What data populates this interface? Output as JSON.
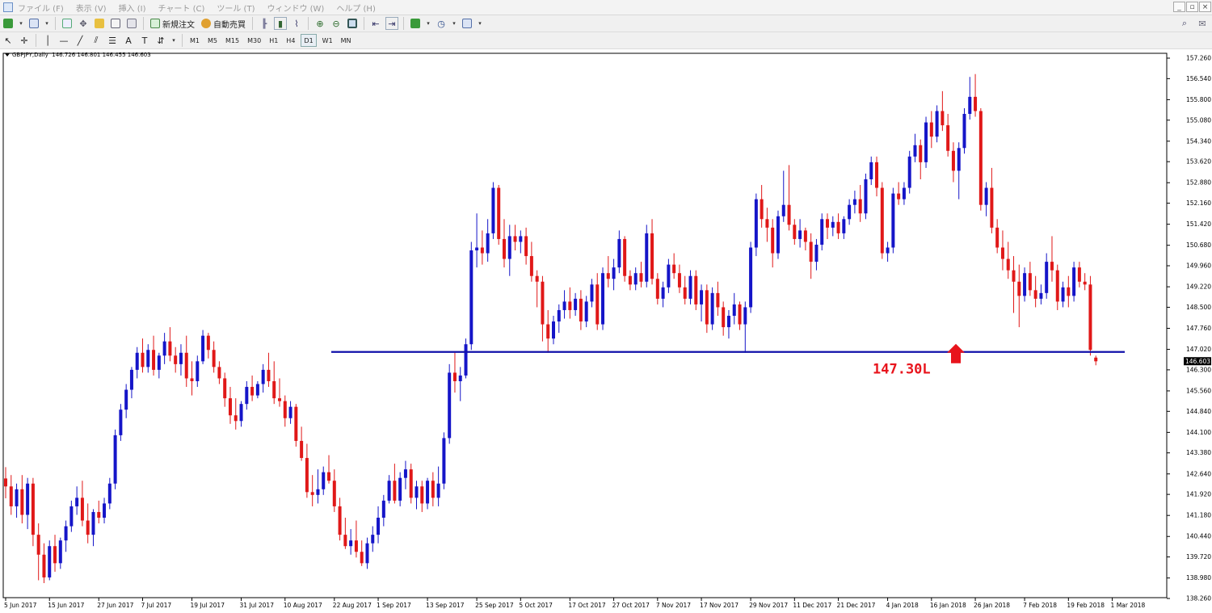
{
  "menu": {
    "items": [
      "ファイル (F)",
      "表示 (V)",
      "挿入 (I)",
      "チャート (C)",
      "ツール (T)",
      "ウィンドウ (W)",
      "ヘルプ (H)"
    ]
  },
  "toolbar": {
    "new_order_label": "新規注文",
    "auto_trading_label": "自動売買",
    "timeframes": [
      "M1",
      "M5",
      "M15",
      "M30",
      "H1",
      "H4",
      "D1",
      "W1",
      "MN"
    ],
    "active_timeframe": "D1"
  },
  "chart_title": {
    "symbol": "GBPJPY,Daily",
    "ohlc": "146.726 146.801 146.455 146.603"
  },
  "annotation": {
    "label": "147.30L",
    "color": "#e8141c"
  },
  "colors": {
    "bull": "#1515c8",
    "bear": "#e01818",
    "support_line": "#1111aa",
    "price_tag_bg": "#000000"
  },
  "chart_data": {
    "type": "candlestick",
    "symbol": "GBPJPY",
    "timeframe": "Daily",
    "y_axis": {
      "min": 138.26,
      "max": 157.26,
      "ticks": [
        157.26,
        156.54,
        155.8,
        155.08,
        154.34,
        153.62,
        152.88,
        152.16,
        151.42,
        150.68,
        149.96,
        149.22,
        148.5,
        147.76,
        147.02,
        146.3,
        145.56,
        144.84,
        144.1,
        143.38,
        142.64,
        141.92,
        141.18,
        140.44,
        139.72,
        138.98,
        138.26
      ],
      "current_price": 146.603,
      "current_price_label": "146.603"
    },
    "x_axis": {
      "labels": [
        "5 Jun 2017",
        "15 Jun 2017",
        "27 Jun 2017",
        "7 Jul 2017",
        "19 Jul 2017",
        "31 Jul 2017",
        "10 Aug 2017",
        "22 Aug 2017",
        "1 Sep 2017",
        "13 Sep 2017",
        "25 Sep 2017",
        "5 Oct 2017",
        "17 Oct 2017",
        "27 Oct 2017",
        "7 Nov 2017",
        "17 Nov 2017",
        "29 Nov 2017",
        "11 Dec 2017",
        "21 Dec 2017",
        "4 Jan 2018",
        "16 Jan 2018",
        "26 Jan 2018",
        "7 Feb 2018",
        "19 Feb 2018",
        "1 Mar 2018"
      ]
    },
    "horizontal_line": {
      "price": 146.93
    },
    "candles": [
      [
        142.48,
        142.88,
        141.78,
        142.2
      ],
      [
        142.2,
        142.6,
        141.2,
        141.5
      ],
      [
        141.5,
        142.3,
        141.1,
        142.1
      ],
      [
        142.1,
        142.6,
        140.9,
        141.2
      ],
      [
        141.2,
        142.5,
        140.7,
        142.3
      ],
      [
        142.3,
        142.5,
        140.1,
        140.5
      ],
      [
        140.5,
        140.9,
        138.9,
        139.8
      ],
      [
        139.8,
        140.2,
        138.8,
        139.0
      ],
      [
        139.0,
        140.3,
        138.9,
        140.1
      ],
      [
        140.1,
        140.5,
        139.2,
        139.5
      ],
      [
        139.5,
        140.4,
        139.3,
        140.3
      ],
      [
        140.3,
        141.0,
        139.9,
        140.8
      ],
      [
        140.8,
        141.7,
        140.6,
        141.5
      ],
      [
        141.5,
        142.2,
        141.2,
        141.8
      ],
      [
        141.8,
        142.4,
        140.8,
        141.0
      ],
      [
        141.0,
        141.6,
        140.2,
        140.5
      ],
      [
        140.5,
        141.4,
        140.1,
        141.3
      ],
      [
        141.3,
        141.7,
        140.9,
        141.1
      ],
      [
        141.1,
        141.8,
        140.9,
        141.6
      ],
      [
        141.6,
        142.5,
        141.4,
        142.3
      ],
      [
        142.3,
        144.2,
        142.1,
        144.0
      ],
      [
        144.0,
        145.1,
        143.8,
        144.9
      ],
      [
        144.9,
        145.8,
        144.6,
        145.6
      ],
      [
        145.6,
        146.4,
        145.3,
        146.3
      ],
      [
        146.3,
        147.1,
        146.0,
        146.9
      ],
      [
        146.9,
        147.4,
        146.2,
        146.4
      ],
      [
        146.4,
        147.2,
        146.2,
        147.0
      ],
      [
        147.0,
        147.5,
        146.1,
        146.3
      ],
      [
        146.3,
        146.9,
        146.0,
        146.8
      ],
      [
        146.8,
        147.6,
        146.5,
        147.3
      ],
      [
        147.3,
        147.8,
        146.6,
        146.8
      ],
      [
        146.8,
        147.1,
        146.2,
        146.5
      ],
      [
        146.5,
        147.2,
        146.1,
        146.9
      ],
      [
        146.9,
        147.5,
        145.7,
        146.0
      ],
      [
        146.0,
        146.6,
        145.4,
        145.9
      ],
      [
        145.9,
        146.8,
        145.7,
        146.6
      ],
      [
        146.6,
        147.7,
        146.5,
        147.5
      ],
      [
        147.5,
        147.6,
        146.7,
        147.0
      ],
      [
        147.0,
        147.3,
        146.2,
        146.4
      ],
      [
        146.4,
        146.6,
        145.8,
        146.0
      ],
      [
        146.0,
        146.2,
        145.0,
        145.3
      ],
      [
        145.3,
        145.7,
        144.4,
        144.7
      ],
      [
        144.7,
        145.3,
        144.2,
        144.5
      ],
      [
        144.5,
        145.2,
        144.3,
        145.1
      ],
      [
        145.1,
        145.9,
        144.9,
        145.7
      ],
      [
        145.7,
        146.1,
        145.2,
        145.4
      ],
      [
        145.4,
        145.9,
        145.3,
        145.8
      ],
      [
        145.8,
        146.5,
        145.5,
        146.3
      ],
      [
        146.3,
        146.9,
        145.7,
        145.9
      ],
      [
        145.9,
        146.6,
        145.1,
        145.3
      ],
      [
        145.3,
        146.0,
        145.0,
        145.2
      ],
      [
        145.2,
        145.4,
        144.3,
        144.6
      ],
      [
        144.6,
        145.2,
        144.4,
        145.0
      ],
      [
        145.0,
        145.1,
        143.6,
        143.8
      ],
      [
        143.8,
        144.3,
        143.1,
        143.2
      ],
      [
        143.2,
        143.7,
        141.8,
        142.0
      ],
      [
        142.0,
        142.6,
        141.5,
        141.9
      ],
      [
        141.9,
        142.8,
        141.6,
        142.1
      ],
      [
        142.1,
        142.9,
        141.9,
        142.7
      ],
      [
        142.7,
        143.3,
        142.3,
        142.4
      ],
      [
        142.4,
        142.8,
        141.3,
        141.5
      ],
      [
        141.5,
        141.8,
        140.3,
        140.5
      ],
      [
        140.5,
        141.1,
        140.0,
        140.1
      ],
      [
        140.1,
        140.7,
        139.8,
        140.3
      ],
      [
        140.3,
        141.0,
        139.7,
        139.9
      ],
      [
        139.9,
        140.3,
        139.4,
        139.5
      ],
      [
        139.5,
        140.4,
        139.3,
        140.2
      ],
      [
        140.2,
        140.8,
        139.9,
        140.5
      ],
      [
        140.5,
        141.5,
        140.2,
        141.1
      ],
      [
        141.1,
        141.9,
        140.8,
        141.7
      ],
      [
        141.7,
        142.6,
        141.6,
        142.4
      ],
      [
        142.4,
        143.0,
        141.6,
        141.7
      ],
      [
        141.7,
        142.7,
        141.5,
        142.5
      ],
      [
        142.5,
        143.1,
        142.1,
        142.8
      ],
      [
        142.8,
        143.0,
        141.6,
        141.8
      ],
      [
        141.8,
        142.4,
        141.4,
        142.2
      ],
      [
        142.2,
        142.4,
        141.3,
        141.6
      ],
      [
        141.6,
        142.5,
        141.4,
        142.4
      ],
      [
        142.4,
        142.7,
        141.5,
        141.8
      ],
      [
        141.8,
        142.9,
        141.5,
        142.3
      ],
      [
        142.3,
        144.1,
        142.1,
        143.9
      ],
      [
        143.9,
        146.5,
        143.7,
        146.2
      ],
      [
        146.2,
        146.9,
        145.5,
        145.9
      ],
      [
        145.9,
        146.4,
        145.2,
        146.1
      ],
      [
        146.1,
        147.4,
        146.0,
        147.2
      ],
      [
        147.2,
        150.8,
        147.0,
        150.5
      ],
      [
        150.5,
        151.8,
        149.9,
        150.6
      ],
      [
        150.6,
        151.2,
        150.0,
        150.4
      ],
      [
        150.4,
        151.6,
        150.1,
        151.1
      ],
      [
        151.1,
        152.9,
        150.9,
        152.7
      ],
      [
        152.7,
        152.8,
        150.7,
        150.9
      ],
      [
        150.9,
        151.6,
        149.9,
        150.2
      ],
      [
        150.2,
        151.4,
        149.6,
        151.0
      ],
      [
        151.0,
        151.4,
        150.5,
        150.8
      ],
      [
        150.8,
        151.2,
        150.4,
        151.0
      ],
      [
        151.0,
        151.3,
        150.0,
        150.3
      ],
      [
        150.3,
        150.8,
        149.4,
        149.6
      ],
      [
        149.6,
        149.8,
        148.5,
        149.4
      ],
      [
        149.4,
        149.6,
        147.3,
        147.9
      ],
      [
        147.9,
        148.4,
        146.9,
        147.4
      ],
      [
        147.4,
        148.2,
        147.2,
        148.0
      ],
      [
        148.0,
        148.6,
        147.6,
        148.4
      ],
      [
        148.4,
        149.1,
        148.1,
        148.7
      ],
      [
        148.7,
        149.2,
        148.1,
        148.4
      ],
      [
        148.4,
        149.0,
        148.2,
        148.8
      ],
      [
        148.8,
        149.1,
        147.7,
        148.0
      ],
      [
        148.0,
        148.9,
        147.8,
        148.7
      ],
      [
        148.7,
        149.5,
        148.5,
        149.3
      ],
      [
        149.3,
        149.7,
        147.7,
        147.9
      ],
      [
        147.9,
        149.9,
        147.7,
        149.7
      ],
      [
        149.7,
        150.3,
        149.2,
        149.5
      ],
      [
        149.5,
        150.2,
        149.1,
        149.9
      ],
      [
        149.9,
        151.2,
        149.7,
        150.9
      ],
      [
        150.9,
        151.0,
        149.4,
        149.6
      ],
      [
        149.6,
        149.8,
        149.1,
        149.3
      ],
      [
        149.3,
        149.9,
        149.1,
        149.7
      ],
      [
        149.7,
        150.1,
        149.2,
        149.4
      ],
      [
        149.4,
        151.4,
        149.2,
        151.1
      ],
      [
        151.1,
        151.6,
        149.3,
        149.5
      ],
      [
        149.5,
        149.7,
        148.6,
        148.8
      ],
      [
        148.8,
        149.4,
        148.5,
        149.2
      ],
      [
        149.2,
        150.2,
        149.0,
        150.0
      ],
      [
        150.0,
        150.4,
        149.5,
        149.7
      ],
      [
        149.7,
        150.0,
        149.0,
        149.2
      ],
      [
        149.2,
        149.6,
        148.6,
        148.8
      ],
      [
        148.8,
        149.8,
        148.6,
        149.6
      ],
      [
        149.6,
        149.8,
        148.4,
        148.6
      ],
      [
        148.6,
        149.3,
        148.0,
        149.1
      ],
      [
        149.1,
        149.3,
        147.6,
        147.9
      ],
      [
        147.9,
        149.2,
        147.7,
        149.0
      ],
      [
        149.0,
        149.4,
        148.2,
        148.5
      ],
      [
        148.5,
        148.7,
        147.5,
        147.8
      ],
      [
        147.8,
        148.4,
        147.4,
        148.2
      ],
      [
        148.2,
        149.0,
        147.9,
        148.6
      ],
      [
        148.6,
        148.7,
        147.7,
        147.9
      ],
      [
        147.9,
        148.7,
        146.9,
        148.5
      ],
      [
        148.5,
        150.8,
        148.3,
        150.6
      ],
      [
        150.6,
        152.5,
        150.3,
        152.3
      ],
      [
        152.3,
        152.8,
        151.3,
        151.6
      ],
      [
        151.6,
        152.0,
        150.8,
        151.3
      ],
      [
        151.3,
        151.6,
        149.9,
        150.4
      ],
      [
        150.4,
        151.9,
        150.2,
        151.7
      ],
      [
        151.7,
        153.3,
        151.5,
        152.1
      ],
      [
        152.1,
        153.5,
        151.2,
        151.4
      ],
      [
        151.4,
        151.6,
        150.7,
        150.9
      ],
      [
        150.9,
        151.6,
        150.6,
        151.2
      ],
      [
        151.2,
        151.3,
        150.5,
        150.8
      ],
      [
        150.8,
        151.1,
        149.5,
        150.1
      ],
      [
        150.1,
        150.9,
        149.8,
        150.7
      ],
      [
        150.7,
        151.8,
        150.5,
        151.6
      ],
      [
        151.6,
        151.8,
        150.9,
        151.3
      ],
      [
        151.3,
        151.7,
        151.0,
        151.5
      ],
      [
        151.5,
        151.8,
        150.9,
        151.1
      ],
      [
        151.1,
        151.7,
        150.9,
        151.6
      ],
      [
        151.6,
        152.3,
        151.4,
        152.1
      ],
      [
        152.1,
        152.6,
        151.8,
        152.3
      ],
      [
        152.3,
        152.8,
        151.5,
        151.8
      ],
      [
        151.8,
        153.2,
        151.6,
        153.0
      ],
      [
        153.0,
        153.8,
        152.8,
        153.6
      ],
      [
        153.6,
        153.8,
        152.4,
        152.7
      ],
      [
        152.7,
        152.9,
        150.2,
        150.4
      ],
      [
        150.4,
        150.8,
        150.1,
        150.6
      ],
      [
        150.6,
        152.7,
        150.4,
        152.5
      ],
      [
        152.5,
        152.9,
        152.1,
        152.3
      ],
      [
        152.3,
        152.9,
        152.1,
        152.7
      ],
      [
        152.7,
        154.0,
        152.5,
        153.8
      ],
      [
        153.8,
        154.6,
        153.6,
        154.2
      ],
      [
        154.2,
        154.4,
        153.0,
        153.6
      ],
      [
        153.6,
        155.2,
        153.4,
        155.0
      ],
      [
        155.0,
        155.4,
        154.1,
        154.5
      ],
      [
        154.5,
        155.6,
        154.3,
        155.4
      ],
      [
        155.4,
        156.1,
        154.7,
        154.9
      ],
      [
        154.9,
        155.3,
        153.8,
        154.0
      ],
      [
        154.0,
        154.3,
        152.9,
        153.3
      ],
      [
        153.3,
        154.3,
        152.3,
        154.1
      ],
      [
        154.1,
        155.5,
        153.9,
        155.3
      ],
      [
        155.3,
        156.6,
        155.1,
        155.9
      ],
      [
        155.9,
        156.7,
        155.2,
        155.4
      ],
      [
        155.4,
        155.5,
        151.9,
        152.1
      ],
      [
        152.1,
        152.9,
        151.7,
        152.7
      ],
      [
        152.7,
        153.4,
        151.1,
        151.3
      ],
      [
        151.3,
        151.6,
        150.4,
        150.6
      ],
      [
        150.6,
        151.2,
        149.8,
        150.2
      ],
      [
        150.2,
        150.8,
        149.5,
        149.8
      ],
      [
        149.8,
        150.3,
        148.3,
        149.4
      ],
      [
        149.4,
        150.0,
        147.8,
        148.9
      ],
      [
        148.9,
        149.9,
        148.7,
        149.7
      ],
      [
        149.7,
        150.1,
        148.9,
        149.1
      ],
      [
        149.1,
        149.6,
        148.5,
        148.8
      ],
      [
        148.8,
        149.3,
        148.6,
        149.0
      ],
      [
        149.0,
        150.4,
        148.8,
        150.1
      ],
      [
        150.1,
        151.0,
        149.4,
        149.8
      ],
      [
        149.8,
        150.0,
        148.4,
        148.7
      ],
      [
        148.7,
        149.4,
        148.5,
        149.2
      ],
      [
        149.2,
        149.6,
        148.5,
        148.9
      ],
      [
        148.9,
        150.1,
        148.7,
        149.9
      ],
      [
        149.9,
        150.1,
        149.2,
        149.4
      ],
      [
        149.4,
        149.7,
        149.1,
        149.3
      ],
      [
        149.3,
        149.6,
        146.8,
        147.0
      ],
      [
        146.73,
        146.8,
        146.46,
        146.6
      ]
    ]
  }
}
